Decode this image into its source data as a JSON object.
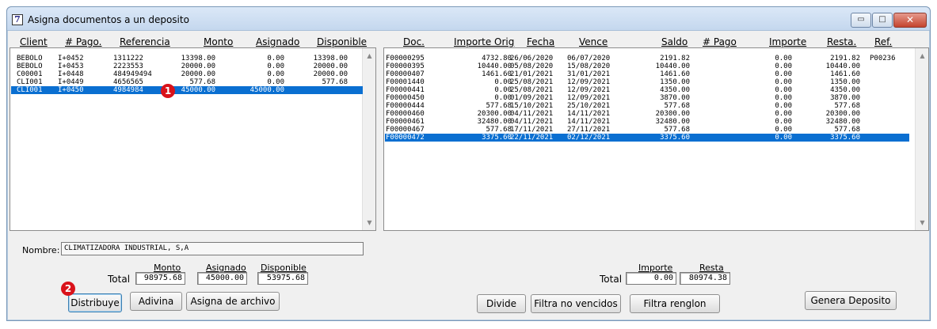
{
  "window": {
    "title": "Asigna documentos a un deposito",
    "icon_glyph": "7",
    "controls": {
      "min": "▭",
      "max": "□",
      "close": "✕"
    }
  },
  "left_table": {
    "headers": [
      "Client",
      "# Pago.",
      "Referencia",
      "Monto",
      "Asignado",
      "Disponible"
    ],
    "rows": [
      [
        "BEBOLO",
        "I+0452",
        "1311222",
        "13398.00",
        "0.00",
        "13398.00"
      ],
      [
        "BEBOLO",
        "I+0453",
        "2223553",
        "20000.00",
        "0.00",
        "20000.00"
      ],
      [
        "C00001",
        "I+0448",
        "484949494",
        "20000.00",
        "0.00",
        "20000.00"
      ],
      [
        "CLI001",
        "I+0449",
        "4656565",
        "577.68",
        "0.00",
        "577.68"
      ],
      [
        "CLI001",
        "I+0450",
        "4984984",
        "45000.00",
        "45000.00",
        ""
      ]
    ],
    "selected_row": 4
  },
  "right_table": {
    "headers": [
      "Doc.",
      "Importe Orig",
      "Fecha",
      "Vence",
      "Saldo",
      "# Pago",
      "Importe",
      "Resta.",
      "Ref."
    ],
    "rows": [
      [
        "F00000295",
        "4732.80",
        "26/06/2020",
        "06/07/2020",
        "2191.82",
        "",
        "0.00",
        "2191.82",
        "P00236"
      ],
      [
        "F00000395",
        "10440.00",
        "05/08/2020",
        "15/08/2020",
        "10440.00",
        "",
        "0.00",
        "10440.00",
        ""
      ],
      [
        "F00000407",
        "1461.60",
        "21/01/2021",
        "31/01/2021",
        "1461.60",
        "",
        "0.00",
        "1461.60",
        ""
      ],
      [
        "F00001440",
        "0.00",
        "25/08/2021",
        "12/09/2021",
        "1350.00",
        "",
        "0.00",
        "1350.00",
        ""
      ],
      [
        "F00000441",
        "0.00",
        "25/08/2021",
        "12/09/2021",
        "4350.00",
        "",
        "0.00",
        "4350.00",
        ""
      ],
      [
        "F00000450",
        "0.00",
        "01/09/2021",
        "12/09/2021",
        "3870.00",
        "",
        "0.00",
        "3870.00",
        ""
      ],
      [
        "F00000444",
        "577.68",
        "15/10/2021",
        "25/10/2021",
        "577.68",
        "",
        "0.00",
        "577.68",
        ""
      ],
      [
        "F00000460",
        "20300.00",
        "04/11/2021",
        "14/11/2021",
        "20300.00",
        "",
        "0.00",
        "20300.00",
        ""
      ],
      [
        "F00000461",
        "32480.00",
        "04/11/2021",
        "14/11/2021",
        "32480.00",
        "",
        "0.00",
        "32480.00",
        ""
      ],
      [
        "F00000467",
        "577.68",
        "17/11/2021",
        "27/11/2021",
        "577.68",
        "",
        "0.00",
        "577.68",
        ""
      ],
      [
        "F00000472",
        "3375.60",
        "22/11/2021",
        "02/12/2021",
        "3375.60",
        "",
        "0.00",
        "3375.60",
        ""
      ]
    ],
    "selected_row": 10
  },
  "nombre": {
    "label": "Nombre:",
    "value": "CLIMATIZADORA INDUSTRIAL, S,A"
  },
  "left_totals": {
    "label": "Total",
    "monto_label": "Monto",
    "asignado_label": "Asignado",
    "disponible_label": "Disponible",
    "monto": "98975.68",
    "asignado": "45000.00",
    "disponible": "53975.68"
  },
  "right_totals": {
    "label": "Total",
    "importe_label": "Importe",
    "resta_label": "Resta",
    "importe": "0.00",
    "resta": "80974.38"
  },
  "buttons": {
    "distribuye": "Distribuye",
    "adivina": "Adivina",
    "asigna_archivo": "Asigna de archivo",
    "divide": "Divide",
    "filtra_no_vencidos": "Filtra no vencidos",
    "filtra_renglon": "Filtra renglon",
    "genera_deposito": "Genera Deposito"
  },
  "markers": {
    "m1": "1",
    "m2": "2"
  },
  "colors": {
    "selection": "#0a6fd1",
    "marker": "#d9121a"
  }
}
